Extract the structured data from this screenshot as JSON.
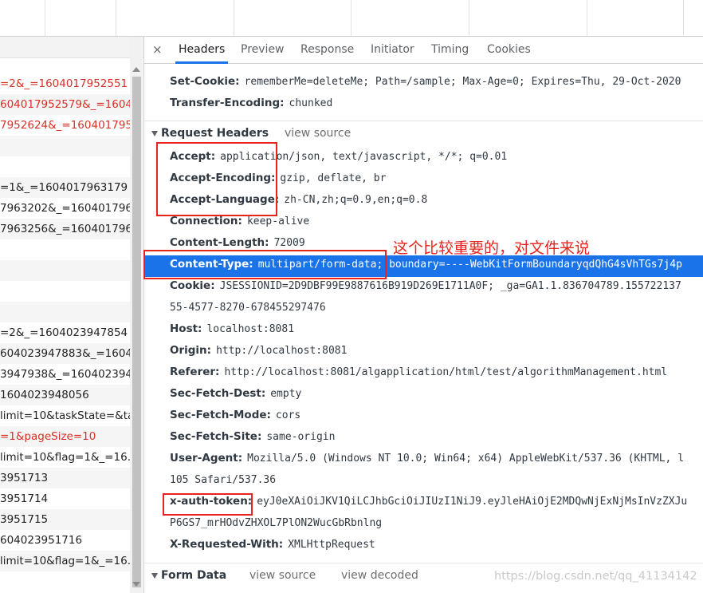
{
  "tabs": [
    {
      "label": "Headers"
    },
    {
      "label": "Preview"
    },
    {
      "label": "Response"
    },
    {
      "label": "Initiator"
    },
    {
      "label": "Timing"
    },
    {
      "label": "Cookies"
    }
  ],
  "close_symbol": "×",
  "request_list": [
    {
      "text": "=2&_=1604017952551",
      "color": "red"
    },
    {
      "text": "604017952579&_=16040",
      "color": "red"
    },
    {
      "text": "7952624&_=160401795...",
      "color": "red"
    },
    {
      "text": "",
      "color": "black"
    },
    {
      "text": "",
      "color": "black"
    },
    {
      "text": "=1&_=1604017963179",
      "color": "black"
    },
    {
      "text": "7963202&_=160401796...",
      "color": "black"
    },
    {
      "text": "7963256&_=160401796...",
      "color": "black"
    },
    {
      "text": "",
      "color": "black"
    },
    {
      "text": "",
      "color": "black"
    },
    {
      "text": "",
      "color": "black"
    },
    {
      "text": "",
      "color": "black"
    },
    {
      "text": "=2&_=1604023947854",
      "color": "black"
    },
    {
      "text": "604023947883&_=16040",
      "color": "black"
    },
    {
      "text": "3947938&_=160402394...",
      "color": "black"
    },
    {
      "text": "1604023948056",
      "color": "black"
    },
    {
      "text": "limit=10&taskState=&ta",
      "color": "black"
    },
    {
      "text": "=1&pageSize=10",
      "color": "red"
    },
    {
      "text": "limit=10&flag=1&_=16...",
      "color": "black"
    },
    {
      "text": "3951713",
      "color": "black"
    },
    {
      "text": "3951714",
      "color": "black"
    },
    {
      "text": "3951715",
      "color": "black"
    },
    {
      "text": "604023951716",
      "color": "black"
    },
    {
      "text": "limit=10&flag=1&_=16...",
      "color": "black"
    }
  ],
  "response_headers_partial": [
    {
      "name": "Set-Cookie:",
      "value": "rememberMe=deleteMe; Path=/sample; Max-Age=0; Expires=Thu, 29-Oct-2020"
    },
    {
      "name": "Transfer-Encoding:",
      "value": "chunked"
    }
  ],
  "request_headers_section": {
    "title": "Request Headers",
    "link": "view source"
  },
  "request_headers": [
    {
      "name": "Accept:",
      "value": "application/json, text/javascript, */*; q=0.01"
    },
    {
      "name": "Accept-Encoding:",
      "value": "gzip, deflate, br"
    },
    {
      "name": "Accept-Language:",
      "value": "zh-CN,zh;q=0.9,en;q=0.8"
    },
    {
      "name": "Connection:",
      "value": "keep-alive"
    },
    {
      "name": "Content-Length:",
      "value": "72009"
    },
    {
      "name": "Content-Type:",
      "value": "multipart/form-data",
      "value_rest": "; boundary=----WebKitFormBoundaryqdQhG4sVhTGs7j4p"
    },
    {
      "name": "Cookie:",
      "value": "JSESSIONID=2D9DBF99E9887616B919D269E1711A0F; _ga=GA1.1.836704789.155722137",
      "continuation": "55-4577-8270-678455297476"
    },
    {
      "name": "Host:",
      "value": "localhost:8081"
    },
    {
      "name": "Origin:",
      "value": "http://localhost:8081"
    },
    {
      "name": "Referer:",
      "value": "http://localhost:8081/algapplication/html/test/algorithmManagement.html"
    },
    {
      "name": "Sec-Fetch-Dest:",
      "value": "empty"
    },
    {
      "name": "Sec-Fetch-Mode:",
      "value": "cors"
    },
    {
      "name": "Sec-Fetch-Site:",
      "value": "same-origin"
    },
    {
      "name": "User-Agent:",
      "value": "Mozilla/5.0 (Windows NT 10.0; Win64; x64) AppleWebKit/537.36 (KHTML, l",
      "continuation": "105 Safari/537.36"
    },
    {
      "name": "x-auth-token:",
      "value": "eyJ0eXAiOiJKV1QiLCJhbGciOiJIUzI1NiJ9.eyJleHAiOjE2MDQwNjExNjMsInVzZXJu",
      "continuation": "P6GS7_mrHOdvZHXOL7PlON2WucGbRbnlng"
    },
    {
      "name": "X-Requested-With:",
      "value": "XMLHttpRequest"
    }
  ],
  "form_data_section": {
    "title": "Form Data",
    "link1": "view source",
    "link2": "view decoded"
  },
  "annotation": "这个比较重要的，对文件来说",
  "watermark": "https://blog.csdn.net/qq_41134142",
  "colors": {
    "accent": "#1a73e8",
    "annotation_red": "#e8231e",
    "error_red": "#d93025"
  }
}
